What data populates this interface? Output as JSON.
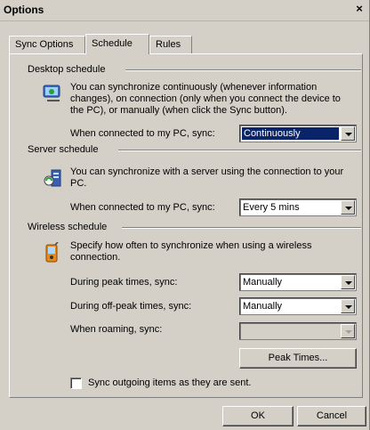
{
  "window": {
    "title": "Options",
    "close_label": "×"
  },
  "tabs": [
    {
      "label": "Sync Options"
    },
    {
      "label": "Schedule"
    },
    {
      "label": "Rules"
    }
  ],
  "desktop": {
    "heading": "Desktop schedule",
    "description": "You can synchronize continuously (whenever information changes), on connection (only when you connect the device to the PC), or manually (when click the Sync button).",
    "sync_label": "When connected to my PC, sync:",
    "sync_value": "Continuously"
  },
  "server": {
    "heading": "Server schedule",
    "description": "You can synchronize with a server using the connection to your PC.",
    "sync_label": "When connected to my PC, sync:",
    "sync_value": "Every 5 mins"
  },
  "wireless": {
    "heading": "Wireless schedule",
    "description": "Specify how often to synchronize when using a wireless connection.",
    "peak_label": "During peak times, sync:",
    "peak_value": "Manually",
    "offpeak_label": "During off-peak times, sync:",
    "offpeak_value": "Manually",
    "roaming_label": "When roaming, sync:",
    "roaming_value": "",
    "peak_times_button": "Peak Times..."
  },
  "outgoing_checkbox": {
    "label": "Sync outgoing items as they are sent.",
    "checked": false
  },
  "footer": {
    "ok_label": "OK",
    "cancel_label": "Cancel"
  }
}
